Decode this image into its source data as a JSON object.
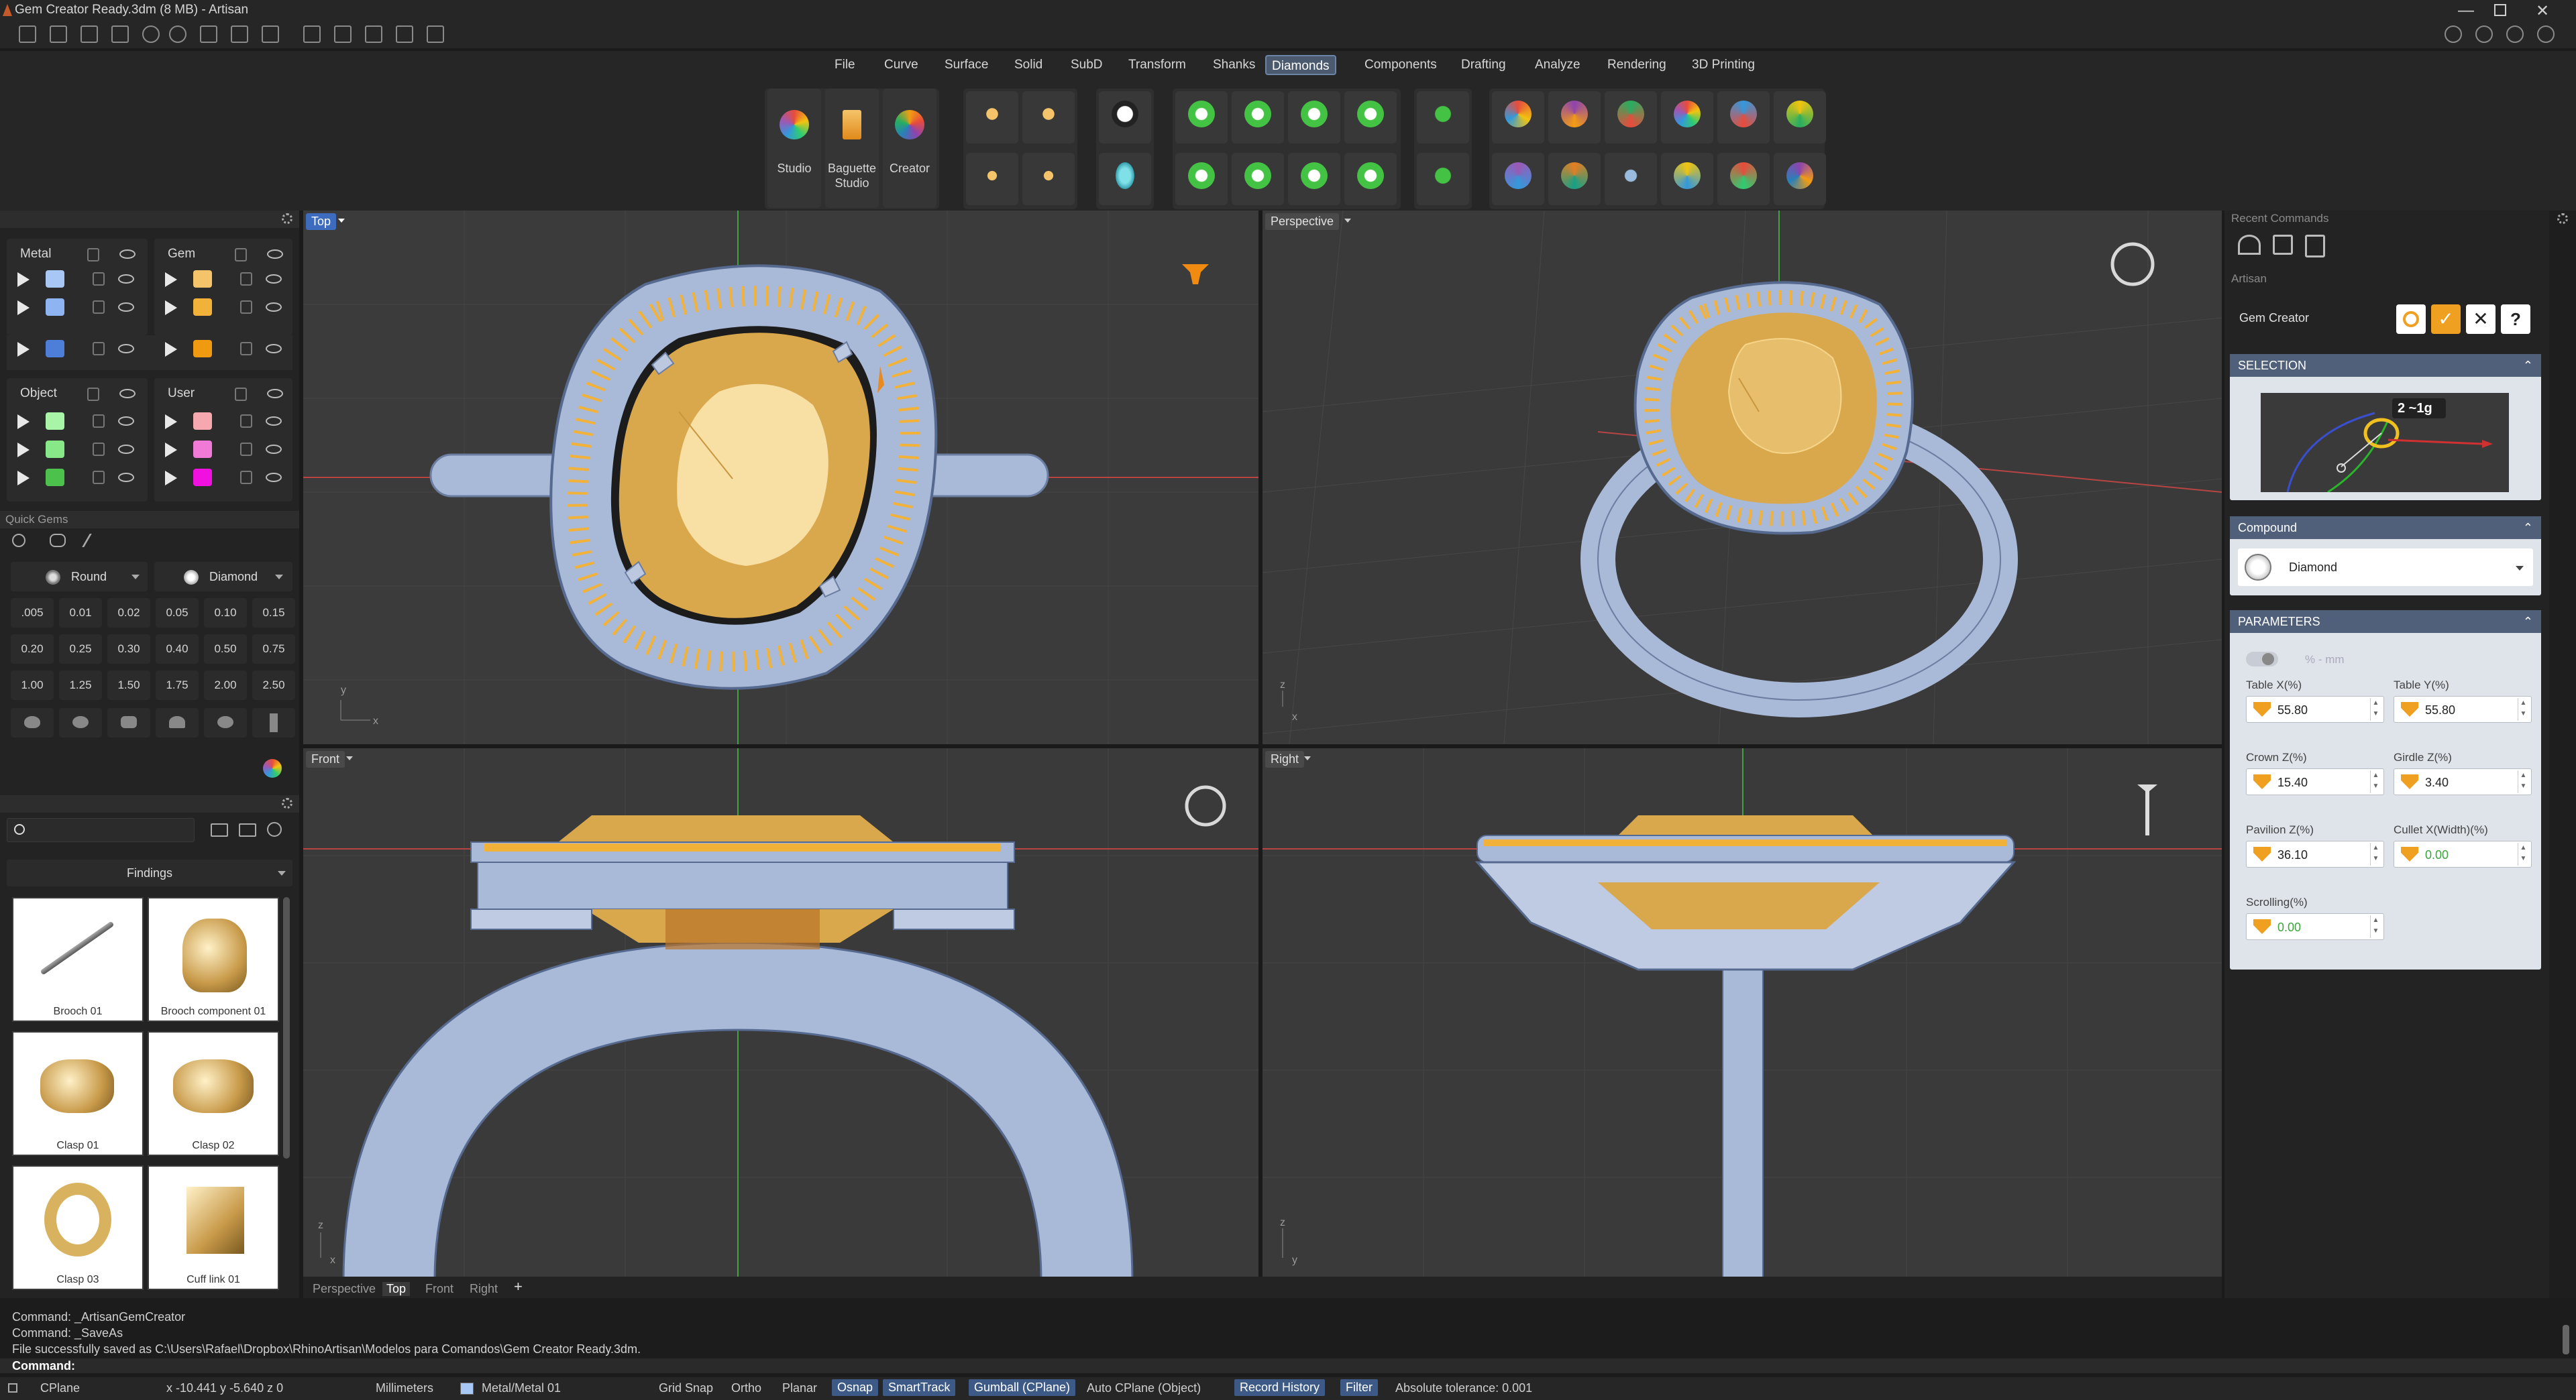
{
  "window": {
    "title": "Gem Creator Ready.3dm (8 MB) - Artisan",
    "controls": [
      "minimize-icon",
      "restore-icon",
      "close-icon"
    ]
  },
  "menu": {
    "items": [
      "File",
      "Curve",
      "Surface",
      "Solid",
      "SubD",
      "Transform",
      "Shanks",
      "Diamonds",
      "Components",
      "Drafting",
      "Analyze",
      "Rendering",
      "3D Printing"
    ],
    "active": "Diamonds"
  },
  "ribbon": {
    "big_buttons": [
      "Studio",
      "Baguette\nStudio",
      "Creator"
    ]
  },
  "layers": {
    "groups": [
      {
        "name": "Metal",
        "colors": [
          "#a9c7f5",
          "#8fb4f2",
          "#4d7fd9"
        ]
      },
      {
        "name": "Gem",
        "colors": [
          "#f5c46a",
          "#f2b23a",
          "#f09a12"
        ]
      },
      {
        "name": "Object",
        "colors": [
          "#a8f5a8",
          "#88e888",
          "#4cc24c"
        ]
      },
      {
        "name": "User",
        "colors": [
          "#f5a8b0",
          "#f07ad6",
          "#f010e0"
        ]
      }
    ]
  },
  "quick_gems": {
    "title": "Quick Gems",
    "shape": "Round",
    "material": "Diamond",
    "sizes": [
      ".005",
      "0.01",
      "0.02",
      "0.05",
      "0.10",
      "0.15",
      "0.20",
      "0.25",
      "0.30",
      "0.40",
      "0.50",
      "0.75",
      "1.00",
      "1.25",
      "1.50",
      "1.75",
      "2.00",
      "2.50"
    ]
  },
  "library": {
    "search_placeholder": "",
    "category": "Findings",
    "items": [
      "Brooch 01",
      "Brooch component 01",
      "Clasp 01",
      "Clasp 02",
      "Clasp 03",
      "Cuff link 01"
    ]
  },
  "viewports": {
    "labels": [
      "Top",
      "Perspective",
      "Front",
      "Right"
    ],
    "active": "Top",
    "tabs": [
      "Perspective",
      "Top",
      "Front",
      "Right"
    ]
  },
  "right_panel": {
    "recent_commands": "Recent Commands",
    "panel_title": "Artisan",
    "command": "Gem Creator",
    "selection_header": "SELECTION",
    "selection_overlay": "2 ~1g",
    "compound_header": "Compound",
    "compound_value": "Diamond",
    "parameters_header": "PARAMETERS",
    "unit_toggle": "% - mm",
    "params": [
      {
        "label": "Table X(%)",
        "value": "55.80",
        "green": false
      },
      {
        "label": "Table Y(%)",
        "value": "55.80",
        "green": false
      },
      {
        "label": "Crown Z(%)",
        "value": "15.40",
        "green": false
      },
      {
        "label": "Girdle Z(%)",
        "value": "3.40",
        "green": false
      },
      {
        "label": "Pavilion Z(%)",
        "value": "36.10",
        "green": false
      },
      {
        "label": "Cullet X(Width)(%)",
        "value": "0.00",
        "green": true
      },
      {
        "label": "Scrolling(%)",
        "value": "0.00",
        "green": true
      }
    ]
  },
  "command_history": [
    "Command: _ArtisanGemCreator",
    "Command: _SaveAs",
    "File successfully saved as C:\\Users\\Rafael\\Dropbox\\RhinoArtisan\\Modelos para Comandos\\Gem Creator Ready.3dm."
  ],
  "command_prompt": "Command:",
  "status": {
    "cplane": "CPlane",
    "coords": "x -10.441   y -5.640   z 0",
    "units": "Millimeters",
    "layer": "Metal/Metal 01",
    "toggles": [
      {
        "label": "Grid Snap",
        "on": false
      },
      {
        "label": "Ortho",
        "on": false
      },
      {
        "label": "Planar",
        "on": false
      },
      {
        "label": "Osnap",
        "on": true
      },
      {
        "label": "SmartTrack",
        "on": true
      },
      {
        "label": "Gumball (CPlane)",
        "on": true
      },
      {
        "label": "Auto CPlane (Object)",
        "on": false
      },
      {
        "label": "Record History",
        "on": true
      },
      {
        "label": "Filter",
        "on": true
      }
    ],
    "tolerance": "Absolute tolerance: 0.001"
  },
  "colors": {
    "accent": "#3d6bbd",
    "gold": "#e6b24a",
    "metal": "#a9b9d8",
    "panel_header": "#50607a"
  }
}
